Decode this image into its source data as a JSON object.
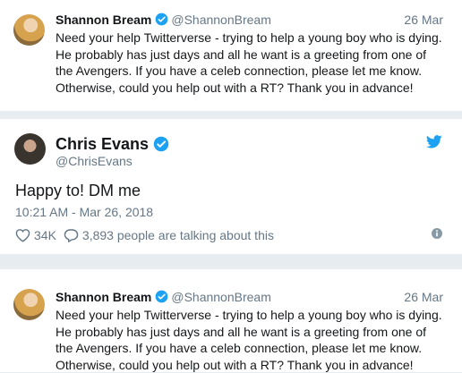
{
  "tweets": [
    {
      "name": "Shannon Bream",
      "handle": "@ShannonBream",
      "date": "26 Mar",
      "text": "Need your help Twitterverse - trying to help a young boy who is dying.\nHe probably has just days and all he want is a greeting from one of\nthe Avengers. If you have a celeb connection, please let me know.\nOtherwise, could you help out with a RT?  Thank you in advance!"
    }
  ],
  "main_tweet": {
    "name": "Chris Evans",
    "handle": "@ChrisEvans",
    "text": "Happy to! DM me",
    "timestamp": "10:21 AM - Mar 26, 2018",
    "likes": "34K",
    "talking": "3,893 people are talking about this"
  },
  "icons": [
    "verified-badge-icon",
    "twitter-bird-icon",
    "heart-icon",
    "reply-bubble-icon",
    "info-icon"
  ],
  "colors": {
    "verified": "#1da1f2",
    "secondary_text": "#657786",
    "background": "#e6ecf0"
  }
}
